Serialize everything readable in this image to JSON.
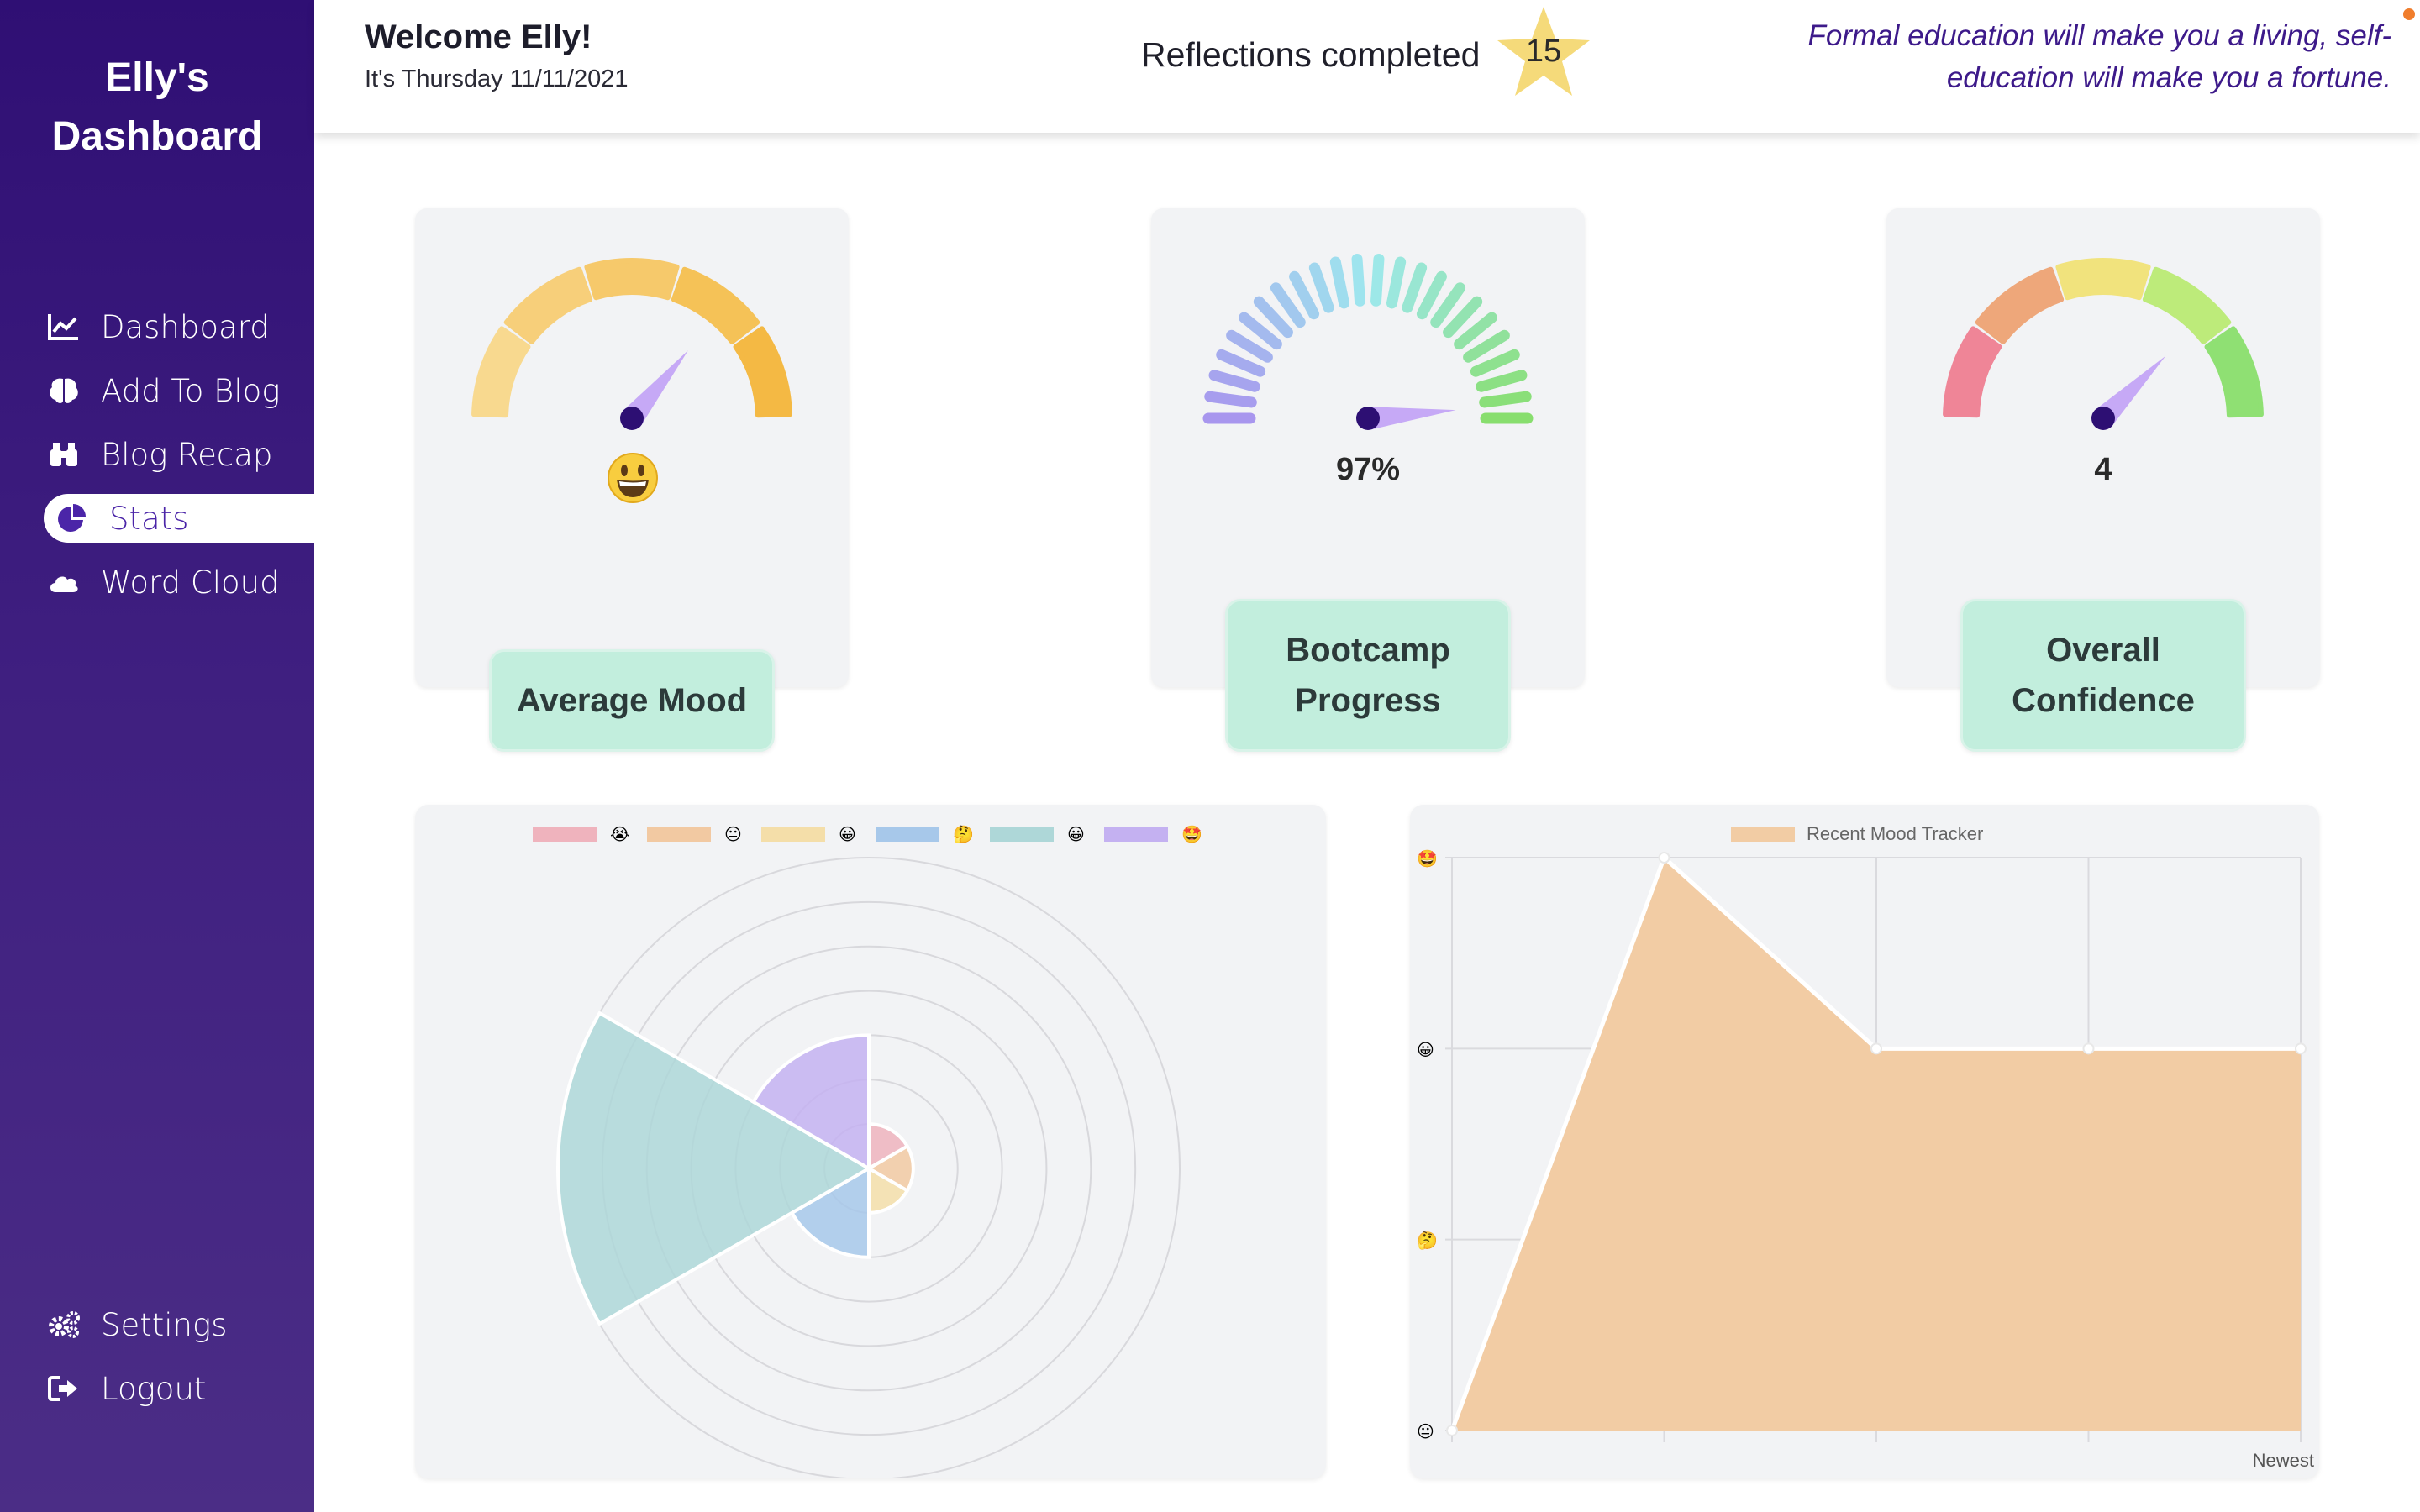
{
  "sidebar": {
    "title": "Elly's Dashboard",
    "items": [
      {
        "label": "Dashboard",
        "icon": "line-chart-icon"
      },
      {
        "label": "Add To Blog",
        "icon": "brain-icon"
      },
      {
        "label": "Blog Recap",
        "icon": "binoculars-icon"
      },
      {
        "label": "Stats",
        "icon": "pie-chart-icon",
        "active": true
      },
      {
        "label": "Word Cloud",
        "icon": "cloud-icon"
      }
    ],
    "bottom": [
      {
        "label": "Settings",
        "icon": "gears-icon"
      },
      {
        "label": "Logout",
        "icon": "logout-icon"
      }
    ]
  },
  "header": {
    "welcome": "Welcome Elly!",
    "date": "It's Thursday 11/11/2021",
    "reflections_label": "Reflections completed",
    "reflections_count": "15",
    "quote": "Formal education will make you a living, self-education will make you a fortune."
  },
  "gauges": [
    {
      "label": "Average Mood",
      "display": "emoji-grinning",
      "level": 0.72,
      "colors": [
        "#f8d98f",
        "#f7cf7a",
        "#f6c96b",
        "#f5c257",
        "#f4b944"
      ]
    },
    {
      "label": "Bootcamp Progress",
      "display": "97%",
      "level": 0.97
    },
    {
      "label": "Overall Confidence",
      "display": "4",
      "level": 0.75,
      "colors": [
        "#ef8597",
        "#eea77a",
        "#f1e37d",
        "#bdeb7a",
        "#8fe073"
      ]
    }
  ],
  "colors": {
    "accent": "#4b25a8",
    "sidebar_top": "#2f0f74",
    "label_bg": "#c2eedd",
    "card_bg": "#f2f3f5",
    "needle": "#c6a9f6",
    "needle_hub": "#2d0f73"
  },
  "chart_data": [
    {
      "type": "polarArea",
      "legend_position": "top",
      "categories": [
        "sad",
        "neutral-ish",
        "happy",
        "thinking",
        "grinning",
        "star-struck"
      ],
      "legend_emojis": [
        "😭",
        "😐",
        "😀",
        "🤔",
        "😀",
        "🤩"
      ],
      "colors": [
        "#efb3bd",
        "#f2c9a2",
        "#f4dea9",
        "#a7c8ea",
        "#aed7d8",
        "#c4b1f1"
      ],
      "values": [
        1,
        1,
        1,
        2,
        7,
        3
      ],
      "rlim": [
        0,
        7
      ]
    },
    {
      "type": "area",
      "title": "Recent Mood Tracker",
      "xlabel": "Newest",
      "y_tick_emojis": [
        "😐",
        "🤔",
        "😀",
        "🤩"
      ],
      "ylim": [
        0,
        3
      ],
      "x": [
        1,
        2,
        3,
        4,
        5
      ],
      "values": [
        0,
        3,
        2,
        2,
        2
      ],
      "color": "#f2cca4"
    }
  ]
}
